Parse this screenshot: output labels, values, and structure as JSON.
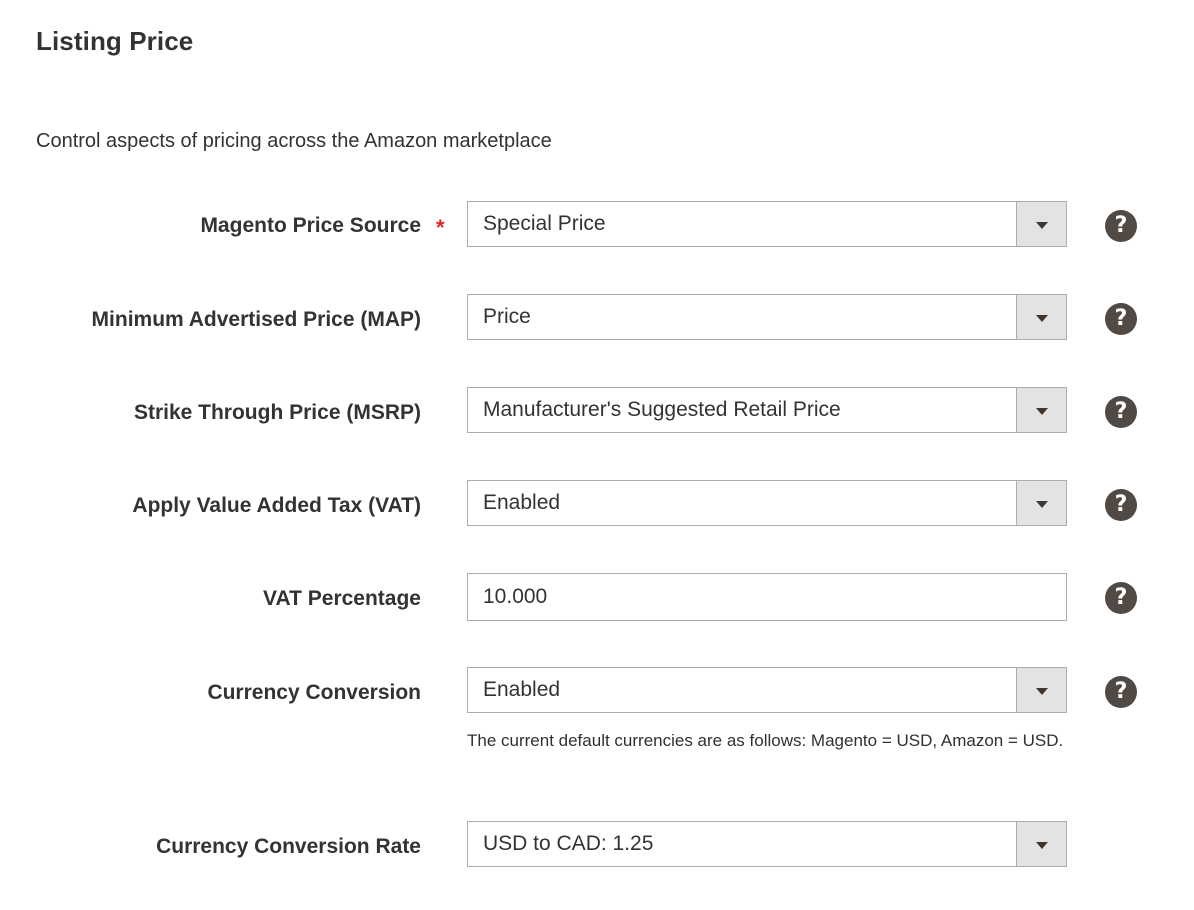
{
  "section": {
    "title": "Listing Price",
    "description": "Control aspects of pricing across the Amazon marketplace"
  },
  "fields": [
    {
      "label": "Magento Price Source",
      "required": true,
      "type": "select",
      "value": "Special Price",
      "help": "?"
    },
    {
      "label": "Minimum Advertised Price (MAP)",
      "required": false,
      "type": "select",
      "value": "Price",
      "help": "?"
    },
    {
      "label": "Strike Through Price (MSRP)",
      "required": false,
      "type": "select",
      "value": "Manufacturer's Suggested Retail Price",
      "help": "?"
    },
    {
      "label": "Apply Value Added Tax (VAT)",
      "required": false,
      "type": "select",
      "value": "Enabled",
      "help": "?"
    },
    {
      "label": "VAT Percentage",
      "required": false,
      "type": "text",
      "value": "10.000",
      "help": "?"
    },
    {
      "label": "Currency Conversion",
      "required": false,
      "type": "select",
      "value": "Enabled",
      "help": "?",
      "note": "The current default currencies are as follows: Magento = USD, Amazon = USD."
    },
    {
      "label": "Currency Conversion Rate",
      "required": false,
      "type": "select",
      "value": "USD to CAD: 1.25"
    }
  ],
  "required_marker": "*",
  "icons": {
    "help": "help-circle-icon",
    "dropdown": "chevron-down-icon"
  },
  "colors": {
    "required": "#e22626",
    "help_bg": "#514943",
    "arrow_bg": "#e3e3e3",
    "border": "#adadad"
  }
}
